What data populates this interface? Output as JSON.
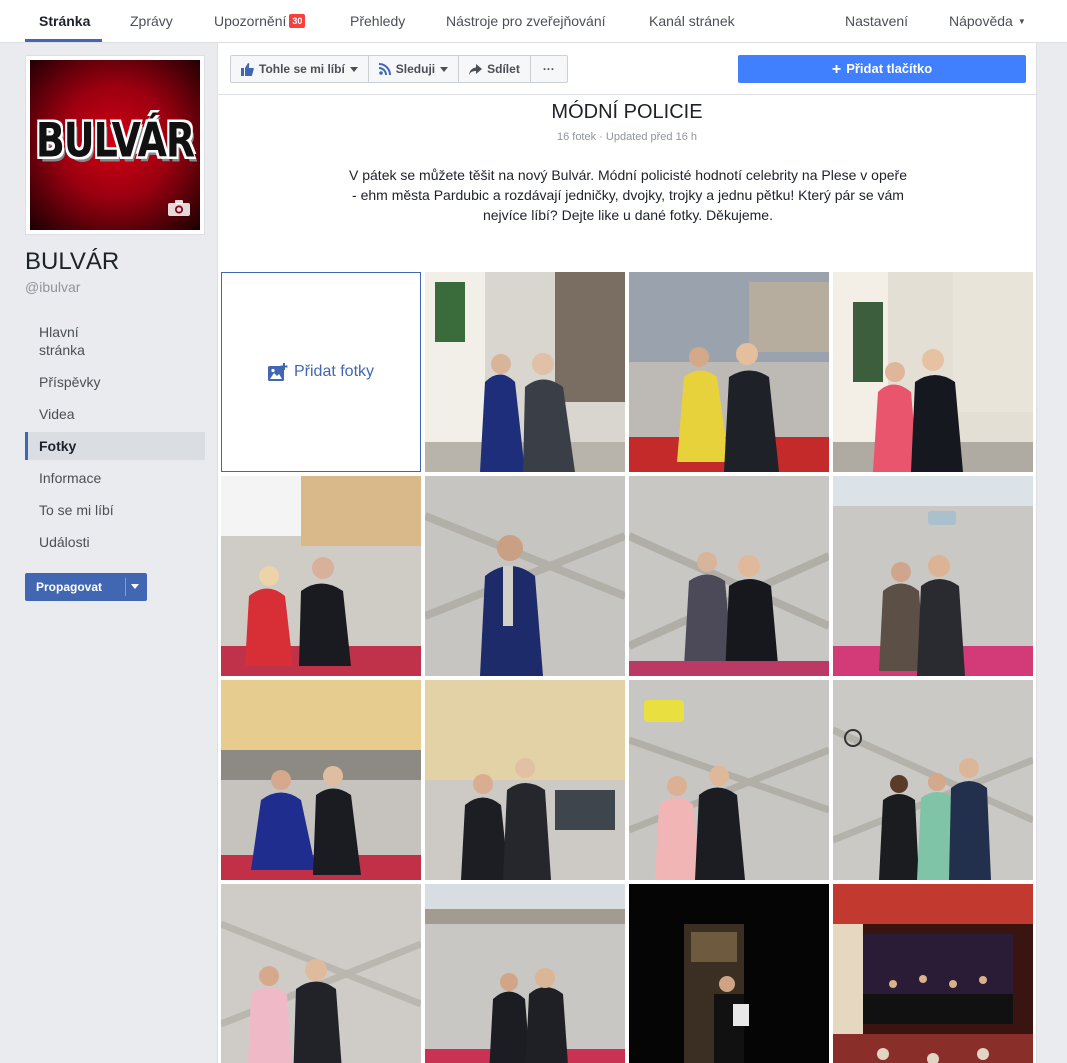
{
  "nav": {
    "tabs": [
      {
        "label": "Stránka"
      },
      {
        "label": "Zprávy"
      },
      {
        "label": "Upozornění",
        "badge": "30"
      },
      {
        "label": "Přehledy"
      },
      {
        "label": "Nástroje pro zveřejňování"
      },
      {
        "label": "Kanál stránek"
      }
    ],
    "settings": "Nastavení",
    "help": "Nápověda"
  },
  "page": {
    "logo_text": "BULVÁR",
    "name": "BULVÁR",
    "handle": "@ibulvar"
  },
  "sidebar": {
    "items": [
      {
        "label": "Hlavní stránka"
      },
      {
        "label": "Příspěvky"
      },
      {
        "label": "Videa"
      },
      {
        "label": "Fotky"
      },
      {
        "label": "Informace"
      },
      {
        "label": "To se mi líbí"
      },
      {
        "label": "Události"
      }
    ],
    "promote": "Propagovat"
  },
  "actions": {
    "like": "Tohle se mi líbí",
    "follow": "Sleduji",
    "share": "Sdílet",
    "more": "···",
    "add_button": "Přidat tlačítko"
  },
  "album": {
    "title": "MÓDNÍ POLICIE",
    "meta": "16 fotek · Updated před 16 h",
    "description": "V pátek se můžete těšit na nový Bulvár. Módní policisté hodnotí celebrity na Plese v opeře - ehm města Pardubic a rozdávají jedničky, dvojky, trojky a jednu pětku! Který pár se vám nejvíce líbí? Dejte like u dané fotky. Děkujeme.",
    "add_photos": "Přidat fotky"
  },
  "colors": {
    "accent": "#4267b2",
    "button_blue": "#4080ff",
    "badge_red": "#fa3e3e"
  }
}
